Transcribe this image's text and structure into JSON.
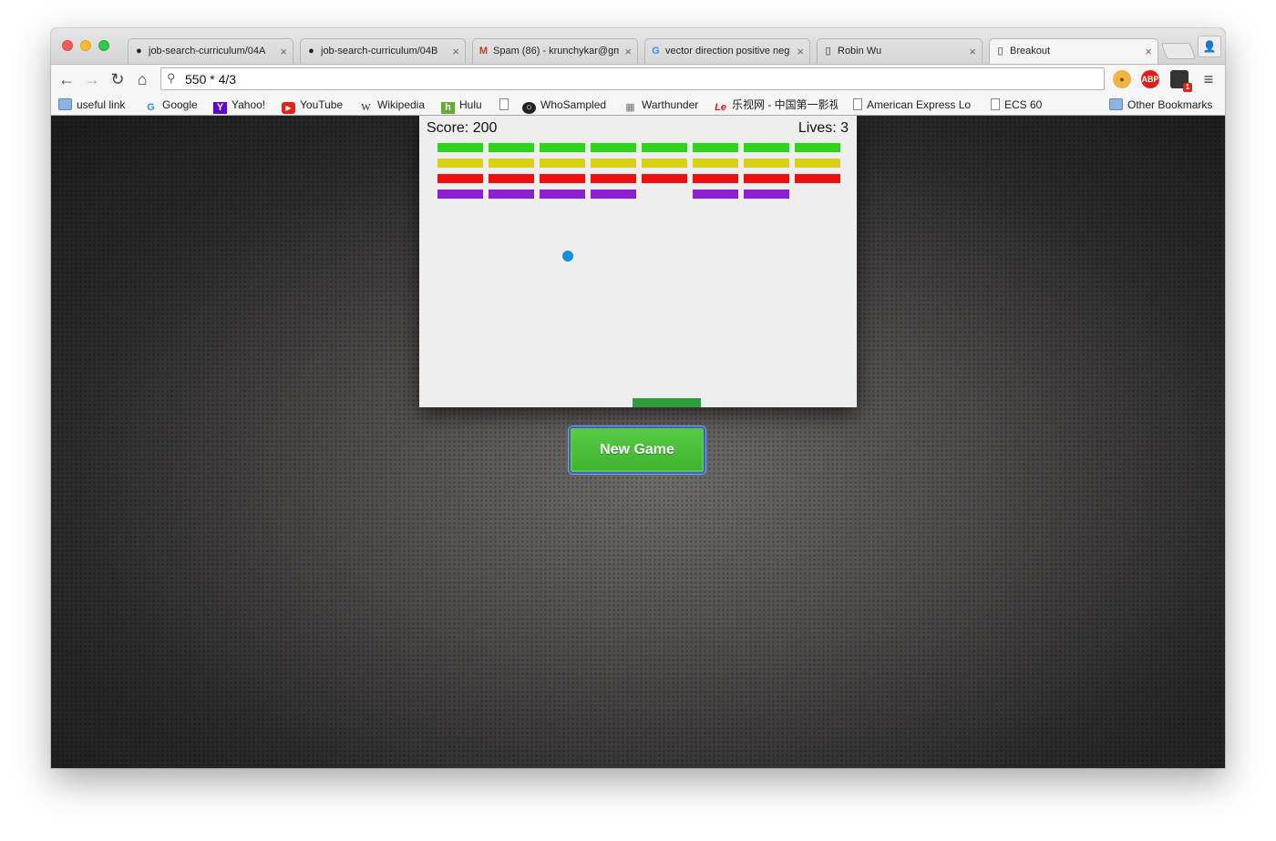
{
  "browser": {
    "tabs": [
      {
        "label": "job-search-curriculum/04A",
        "icon": "github-icon",
        "active": false
      },
      {
        "label": "job-search-curriculum/04B",
        "icon": "github-icon",
        "active": false
      },
      {
        "label": "Spam (86) - krunchykar@gm",
        "icon": "gmail-icon",
        "active": false
      },
      {
        "label": "vector direction positive neg",
        "icon": "google-icon",
        "active": false
      },
      {
        "label": "Robin Wu",
        "icon": "page-icon",
        "active": false
      },
      {
        "label": "Breakout",
        "icon": "page-icon",
        "active": true
      }
    ],
    "tab_close_glyph": "×",
    "address": "550 * 4/3",
    "bookmarks": [
      {
        "label": "useful link",
        "icon": "folder-icon"
      },
      {
        "label": "Google",
        "icon": "google-icon"
      },
      {
        "label": "Yahoo!",
        "icon": "yahoo-icon"
      },
      {
        "label": "YouTube",
        "icon": "youtube-icon"
      },
      {
        "label": "Wikipedia",
        "icon": "wikipedia-icon"
      },
      {
        "label": "Hulu",
        "icon": "hulu-icon"
      },
      {
        "label": "",
        "icon": "page-icon"
      },
      {
        "label": "WhoSampled",
        "icon": "whosampled-icon"
      },
      {
        "label": "Warthunder",
        "icon": "warthunder-icon"
      },
      {
        "label": "乐视网 - 中国第一影视",
        "icon": "letv-icon"
      },
      {
        "label": "American Express Lo",
        "icon": "page-icon"
      },
      {
        "label": "ECS 60",
        "icon": "page-icon"
      }
    ],
    "other_bookmarks": "Other Bookmarks",
    "extensions": [
      "cookie-icon",
      "adblock-plus-icon",
      "extension-icon",
      "chrome-menu-icon"
    ],
    "adblock_label": "ABP",
    "extension_badge": "1"
  },
  "game": {
    "score_label": "Score: 200",
    "lives_label": "Lives: 3",
    "score": 200,
    "lives": 3,
    "brick_rows": [
      {
        "color": "#2fd317",
        "present": [
          true,
          true,
          true,
          true,
          true,
          true,
          true,
          true
        ]
      },
      {
        "color": "#d8d014",
        "present": [
          true,
          true,
          true,
          true,
          true,
          true,
          true,
          true
        ]
      },
      {
        "color": "#ee1010",
        "present": [
          true,
          true,
          true,
          true,
          true,
          true,
          true,
          true
        ]
      },
      {
        "color": "#8d1fd0",
        "present": [
          true,
          true,
          true,
          true,
          false,
          true,
          true,
          false
        ]
      }
    ],
    "ball_color": "#0f8fe0",
    "paddle_color": "#2f9e3a"
  },
  "new_game_button": "New Game"
}
